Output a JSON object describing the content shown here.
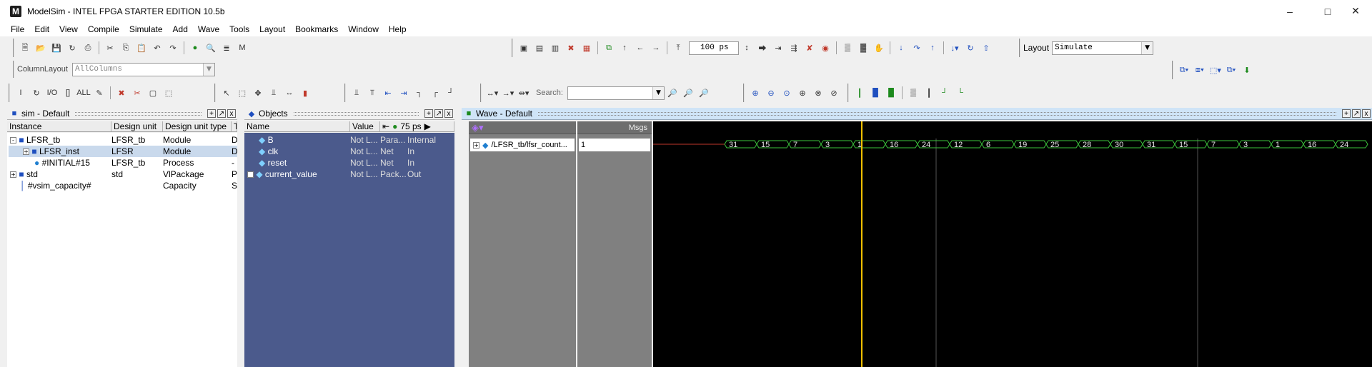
{
  "window": {
    "title": "ModelSim - INTEL FPGA STARTER EDITION 10.5b",
    "logo": "M"
  },
  "menu": [
    "File",
    "Edit",
    "View",
    "Compile",
    "Simulate",
    "Add",
    "Wave",
    "Tools",
    "Layout",
    "Bookmarks",
    "Window",
    "Help"
  ],
  "toolbar": {
    "run_length": "100 ps",
    "layout_label": "Layout",
    "layout_value": "Simulate",
    "column_layout_label": "ColumnLayout",
    "column_layout_value": "AllColumns",
    "search_label": "Search:",
    "search_value": ""
  },
  "sim_pane": {
    "title": "sim - Default",
    "columns": [
      "Instance",
      "Design unit",
      "Design unit type",
      "T"
    ],
    "rows": [
      {
        "instance": "LFSR_tb",
        "unit": "LFSR_tb",
        "type": "Module",
        "t": "D",
        "icon": "module-icon",
        "expander": "-",
        "indent": 0
      },
      {
        "instance": "LFSR_inst",
        "unit": "LFSR",
        "type": "Module",
        "t": "D",
        "icon": "module-icon",
        "expander": "+",
        "indent": 1,
        "selected": true
      },
      {
        "instance": "#INITIAL#15",
        "unit": "LFSR_tb",
        "type": "Process",
        "t": "-",
        "icon": "process-icon",
        "expander": "",
        "indent": 1
      },
      {
        "instance": "std",
        "unit": "std",
        "type": "VlPackage",
        "t": "P",
        "icon": "package-icon",
        "expander": "+",
        "indent": 0
      },
      {
        "instance": "#vsim_capacity#",
        "unit": "",
        "type": "Capacity",
        "t": "S",
        "icon": "capacity-icon",
        "expander": "",
        "indent": 0
      }
    ]
  },
  "objects_pane": {
    "title": "Objects",
    "columns": [
      "Name",
      "Value"
    ],
    "time_display": "75 ps",
    "rows": [
      {
        "name": "B",
        "value": "Not L...",
        "kind": "Para...",
        "mode": "Internal"
      },
      {
        "name": "clk",
        "value": "Not L...",
        "kind": "Net",
        "mode": "In"
      },
      {
        "name": "reset",
        "value": "Not L...",
        "kind": "Net",
        "mode": "In"
      },
      {
        "name": "current_value",
        "value": "Not L...",
        "kind": "Pack...",
        "mode": "Out"
      }
    ]
  },
  "wave_pane": {
    "title": "Wave - Default",
    "msgs_header": "Msgs",
    "signal_name": "/LFSR_tb/lfsr_count...",
    "signal_value": "1",
    "bus_values": [
      "31",
      "15",
      "7",
      "3",
      "1",
      "16",
      "24",
      "12",
      "6",
      "19",
      "25",
      "28",
      "30",
      "31",
      "15",
      "7",
      "3",
      "1",
      "16",
      "24"
    ],
    "cursor_fraction": 0.29
  },
  "colors": {
    "objects_bg": "#4b5a8c",
    "wave_bg": "#000000",
    "wave_green": "#3cc33c",
    "cursor": "#f0c000",
    "pane_header_active": "#cfe4f7"
  }
}
